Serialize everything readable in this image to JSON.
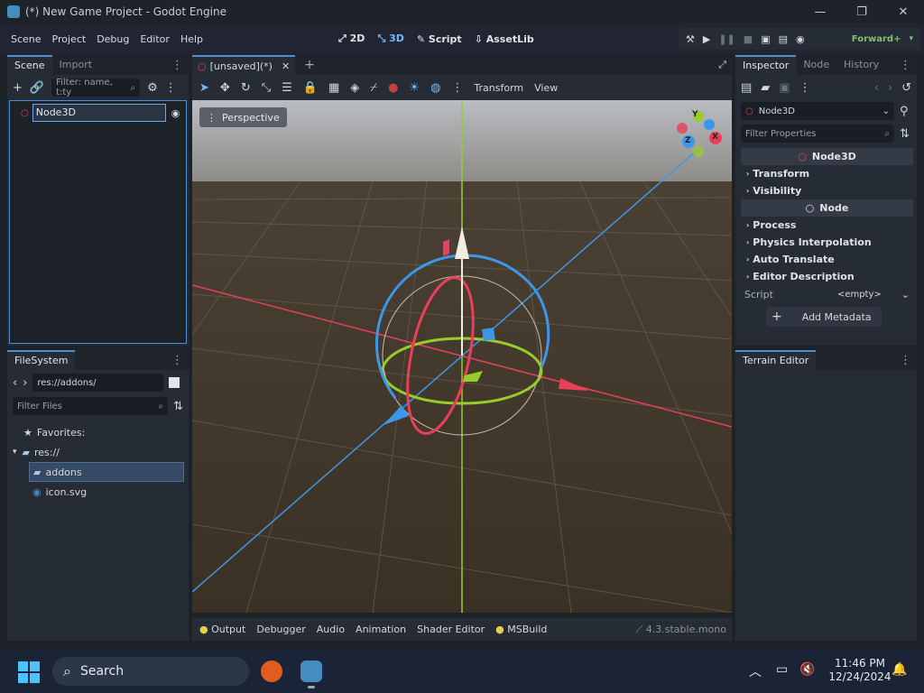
{
  "window": {
    "title": "(*) New Game Project - Godot Engine",
    "minimize": "—",
    "maximize": "❐",
    "close": "✕"
  },
  "menu": {
    "items": [
      "Scene",
      "Project",
      "Debug",
      "Editor",
      "Help"
    ]
  },
  "main_screens": {
    "2d": "2D",
    "3d": "3D",
    "script": "Script",
    "assetlib": "AssetLib"
  },
  "renderer": "Forward+",
  "scene_dock": {
    "tabs": [
      "Scene",
      "Import"
    ],
    "filter_placeholder": "Filter: name, t:ty",
    "root_node": "Node3D"
  },
  "filesystem": {
    "tab": "FileSystem",
    "path": "res://addons/",
    "filter_placeholder": "Filter Files",
    "favorites": "Favorites:",
    "root": "res://",
    "items": [
      "addons",
      "icon.svg"
    ]
  },
  "editor_tabs": {
    "tab": "[unsaved](*)",
    "add": "+"
  },
  "viewport_toolbar": {
    "transform": "Transform",
    "view": "View"
  },
  "viewport": {
    "perspective": "Perspective",
    "gizmo": {
      "x": "X",
      "y": "Y",
      "z": "Z"
    },
    "colors": {
      "x": "#e8405a",
      "y": "#98cc2a",
      "z": "#3b98e8"
    }
  },
  "bottom_panel": {
    "tabs": [
      "Output",
      "Debugger",
      "Audio",
      "Animation",
      "Shader Editor",
      "MSBuild"
    ],
    "version": "4.3.stable.mono"
  },
  "inspector": {
    "tabs": [
      "Inspector",
      "Node",
      "History"
    ],
    "node": "Node3D",
    "filter_placeholder": "Filter Properties",
    "class_node3d": "Node3D",
    "sections": [
      "Transform",
      "Visibility"
    ],
    "class_node": "Node",
    "node_sections": [
      "Process",
      "Physics Interpolation",
      "Auto Translate",
      "Editor Description"
    ],
    "script_label": "Script",
    "script_value": "<empty>",
    "add_metadata": "Add Metadata"
  },
  "terrain": {
    "tab": "Terrain Editor"
  },
  "taskbar": {
    "search": "Search",
    "time": "11:46 PM",
    "date": "12/24/2024"
  }
}
